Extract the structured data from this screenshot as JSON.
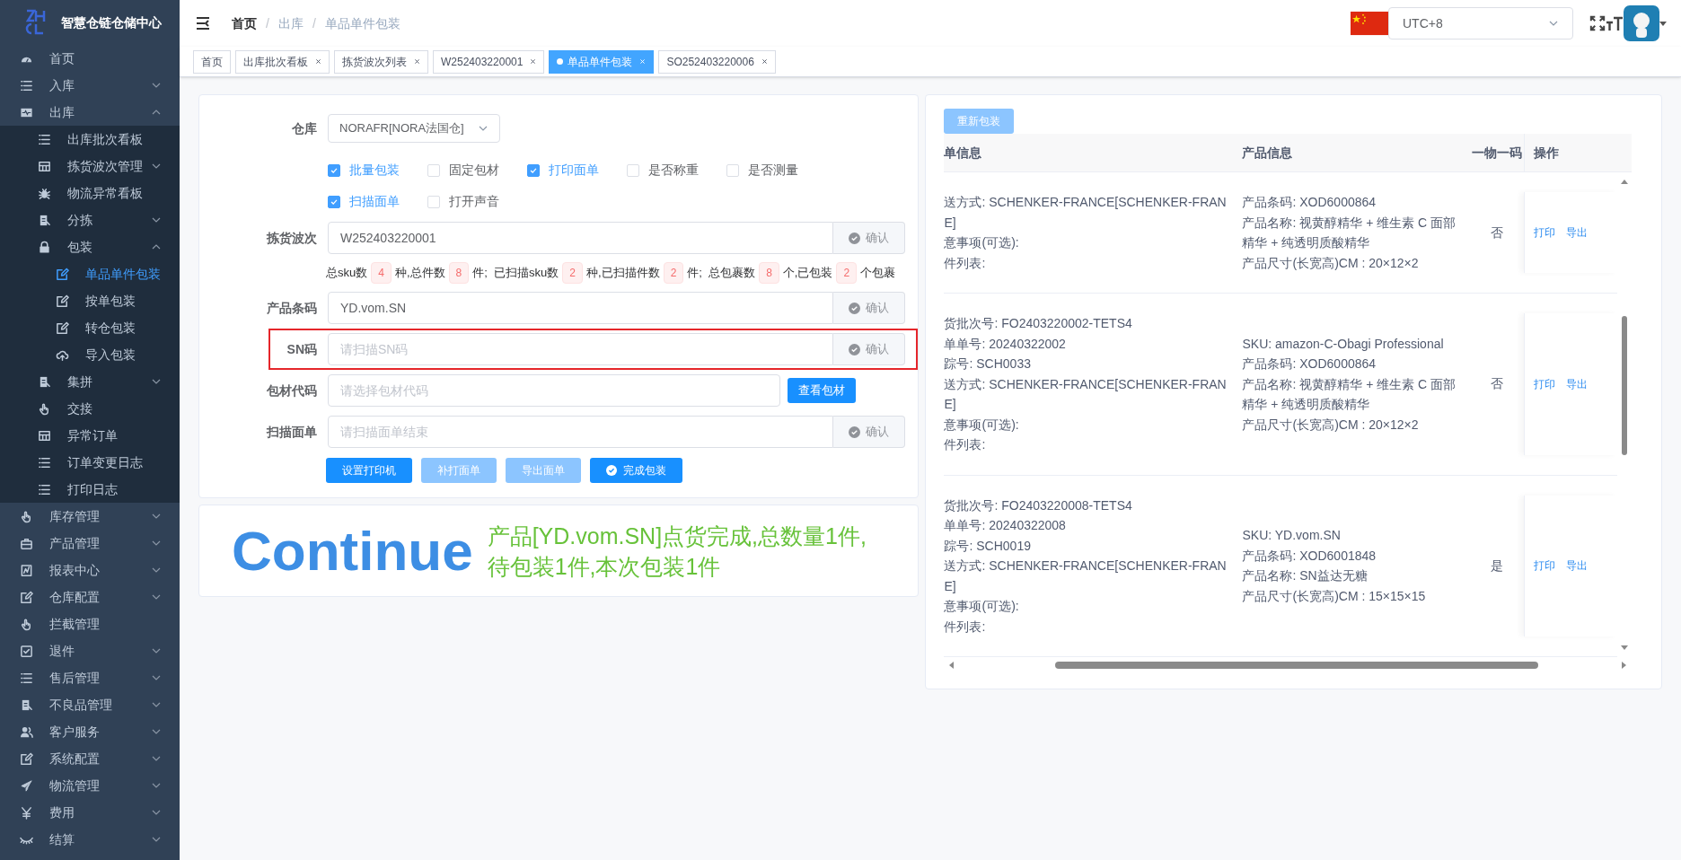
{
  "sidebar": {
    "title": "智慧仓链仓储中心",
    "items": [
      {
        "label": "首页",
        "selected": false
      },
      {
        "label": "入库",
        "selected": false,
        "expanded": false
      },
      {
        "label": "出库",
        "selected": false,
        "expanded": true,
        "children": [
          {
            "label": "出库批次看板",
            "selected": false
          },
          {
            "label": "拣货波次管理",
            "selected": false,
            "expanded": false
          },
          {
            "label": "物流异常看板",
            "selected": false
          },
          {
            "label": "分拣",
            "selected": false,
            "expanded": false
          },
          {
            "label": "包装",
            "selected": false,
            "expanded": true,
            "children": [
              {
                "label": "单品单件包装",
                "selected": true
              },
              {
                "label": "按单包装",
                "selected": false
              },
              {
                "label": "转仓包装",
                "selected": false
              },
              {
                "label": "导入包装",
                "selected": false
              }
            ]
          },
          {
            "label": "集拼",
            "selected": false,
            "expanded": false
          },
          {
            "label": "交接",
            "selected": false
          },
          {
            "label": "异常订单",
            "selected": false
          },
          {
            "label": "订单变更日志",
            "selected": false
          },
          {
            "label": "打印日志",
            "selected": false
          }
        ]
      },
      {
        "label": "库存管理",
        "selected": false,
        "expanded": false
      },
      {
        "label": "产品管理",
        "selected": false,
        "expanded": false
      },
      {
        "label": "报表中心",
        "selected": false,
        "expanded": false
      },
      {
        "label": "仓库配置",
        "selected": false,
        "expanded": false
      },
      {
        "label": "拦截管理",
        "selected": false
      },
      {
        "label": "退件",
        "selected": false,
        "expanded": false
      },
      {
        "label": "售后管理",
        "selected": false,
        "expanded": false
      },
      {
        "label": "不良品管理",
        "selected": false,
        "expanded": false
      },
      {
        "label": "客户服务",
        "selected": false,
        "expanded": false
      },
      {
        "label": "系统配置",
        "selected": false,
        "expanded": false
      },
      {
        "label": "物流管理",
        "selected": false,
        "expanded": false
      },
      {
        "label": "费用",
        "selected": false,
        "expanded": false
      },
      {
        "label": "结算",
        "selected": false,
        "expanded": false
      }
    ]
  },
  "header": {
    "breadcrumb": [
      "首页",
      "出库",
      "单品单件包装"
    ],
    "separator": "/",
    "timezone": "UTC+8"
  },
  "tabs": [
    {
      "label": "首页",
      "selected": false,
      "closable": false
    },
    {
      "label": "出库批次看板",
      "selected": false,
      "closable": true
    },
    {
      "label": "拣货波次列表",
      "selected": false,
      "closable": true
    },
    {
      "label": "W252403220001",
      "selected": false,
      "closable": true
    },
    {
      "label": "单品单件包装",
      "selected": true,
      "closable": true
    },
    {
      "label": "SO252403220006",
      "selected": false,
      "closable": true
    }
  ],
  "form": {
    "rows": [
      {
        "kind": "select",
        "label": "仓库",
        "value": "NORAFR[NORA法国仓]"
      },
      {
        "kind": "checkboxes",
        "options": [
          {
            "label": "批量包装",
            "checked": true
          },
          {
            "label": "固定包材",
            "checked": false
          },
          {
            "label": "打印面单",
            "checked": true
          },
          {
            "label": "是否称重",
            "checked": false
          },
          {
            "label": "是否测量",
            "checked": false
          }
        ]
      },
      {
        "kind": "checkboxes",
        "options": [
          {
            "label": "扫描面单",
            "checked": true
          },
          {
            "label": "打开声音",
            "checked": false
          }
        ]
      },
      {
        "kind": "confirm",
        "label": "拣货波次",
        "value": "W252403220001",
        "button": "确认",
        "highlighted": false
      },
      {
        "kind": "stats",
        "parts": [
          {
            "text": "总sku数",
            "count": "4"
          },
          {
            "text": "种,总件数",
            "count": "8"
          },
          {
            "text": "件;  已扫描sku数",
            "count": "2"
          },
          {
            "text": "种,已扫描件数",
            "count": "2"
          },
          {
            "text": "件;  总包裹数",
            "count": "8"
          },
          {
            "text": "个,已包装",
            "count": "2"
          },
          {
            "text": "个包裹"
          }
        ]
      },
      {
        "kind": "confirm",
        "label": "产品条码",
        "value": "YD.vom.SN",
        "button": "确认",
        "highlighted": false
      },
      {
        "kind": "confirm",
        "label": "SN码",
        "placeholder": "请扫描SN码",
        "button": "确认",
        "highlighted": true
      },
      {
        "kind": "lookup",
        "label": "包材代码",
        "placeholder": "请选择包材代码",
        "button": "查看包材"
      },
      {
        "kind": "confirm",
        "label": "扫描面单",
        "placeholder": "请扫描面单结束",
        "button": "确认",
        "highlighted": false
      },
      {
        "kind": "buttons",
        "buttons": [
          {
            "label": "设置打印机",
            "disabled": false
          },
          {
            "label": "补打面单",
            "disabled": true
          },
          {
            "label": "导出面单",
            "disabled": true
          },
          {
            "label": "完成包装",
            "disabled": false
          }
        ]
      }
    ]
  },
  "result": {
    "headline": "Continue",
    "message": "产品[YD.vom.SN]点货完成,总数量1件,待包装1件,本次包装1件"
  },
  "orders": {
    "repack_button": {
      "label": "重新包装",
      "disabled": true
    },
    "columns": [
      "单信息",
      "产品信息",
      "一物一码",
      "操作"
    ],
    "rows": [
      {
        "order_info": [
          "送方式: SCHENKER-FRANCE[SCHENKER-FRAN",
          "E]",
          "意事项(可选):",
          "件列表:"
        ],
        "product_info": [
          "产品条码: XOD6000864",
          "产品名称: 视黄醇精华 + 维生素 C 面部精华 + 纯透明质酸精华",
          "产品尺寸(长宽高)CM : 20×12×2"
        ],
        "one_code": "否",
        "actions": [
          "打印",
          "导出"
        ]
      },
      {
        "order_info": [
          "货批次号: FO2403220002-TETS4",
          "单单号: 20240322002",
          "踪号: SCH0033",
          "送方式: SCHENKER-FRANCE[SCHENKER-FRAN",
          "E]",
          "意事项(可选):",
          "件列表:"
        ],
        "product_info": [
          "SKU: amazon-C-Obagi Professional",
          "产品条码: XOD6000864",
          "产品名称: 视黄醇精华 + 维生素 C 面部精华 + 纯透明质酸精华",
          "产品尺寸(长宽高)CM : 20×12×2"
        ],
        "one_code": "否",
        "actions": [
          "打印",
          "导出"
        ]
      },
      {
        "order_info": [
          "货批次号: FO2403220008-TETS4",
          "单单号: 20240322008",
          "踪号: SCH0019",
          "送方式: SCHENKER-FRANCE[SCHENKER-FRAN",
          "E]",
          "意事项(可选):",
          "件列表:"
        ],
        "product_info": [
          "SKU: YD.vom.SN",
          "产品条码: XOD6001848",
          "产品名称: SN益达无糖",
          "产品尺寸(长宽高)CM : 15×15×15"
        ],
        "one_code": "是",
        "actions": [
          "打印",
          "导出"
        ]
      }
    ]
  }
}
